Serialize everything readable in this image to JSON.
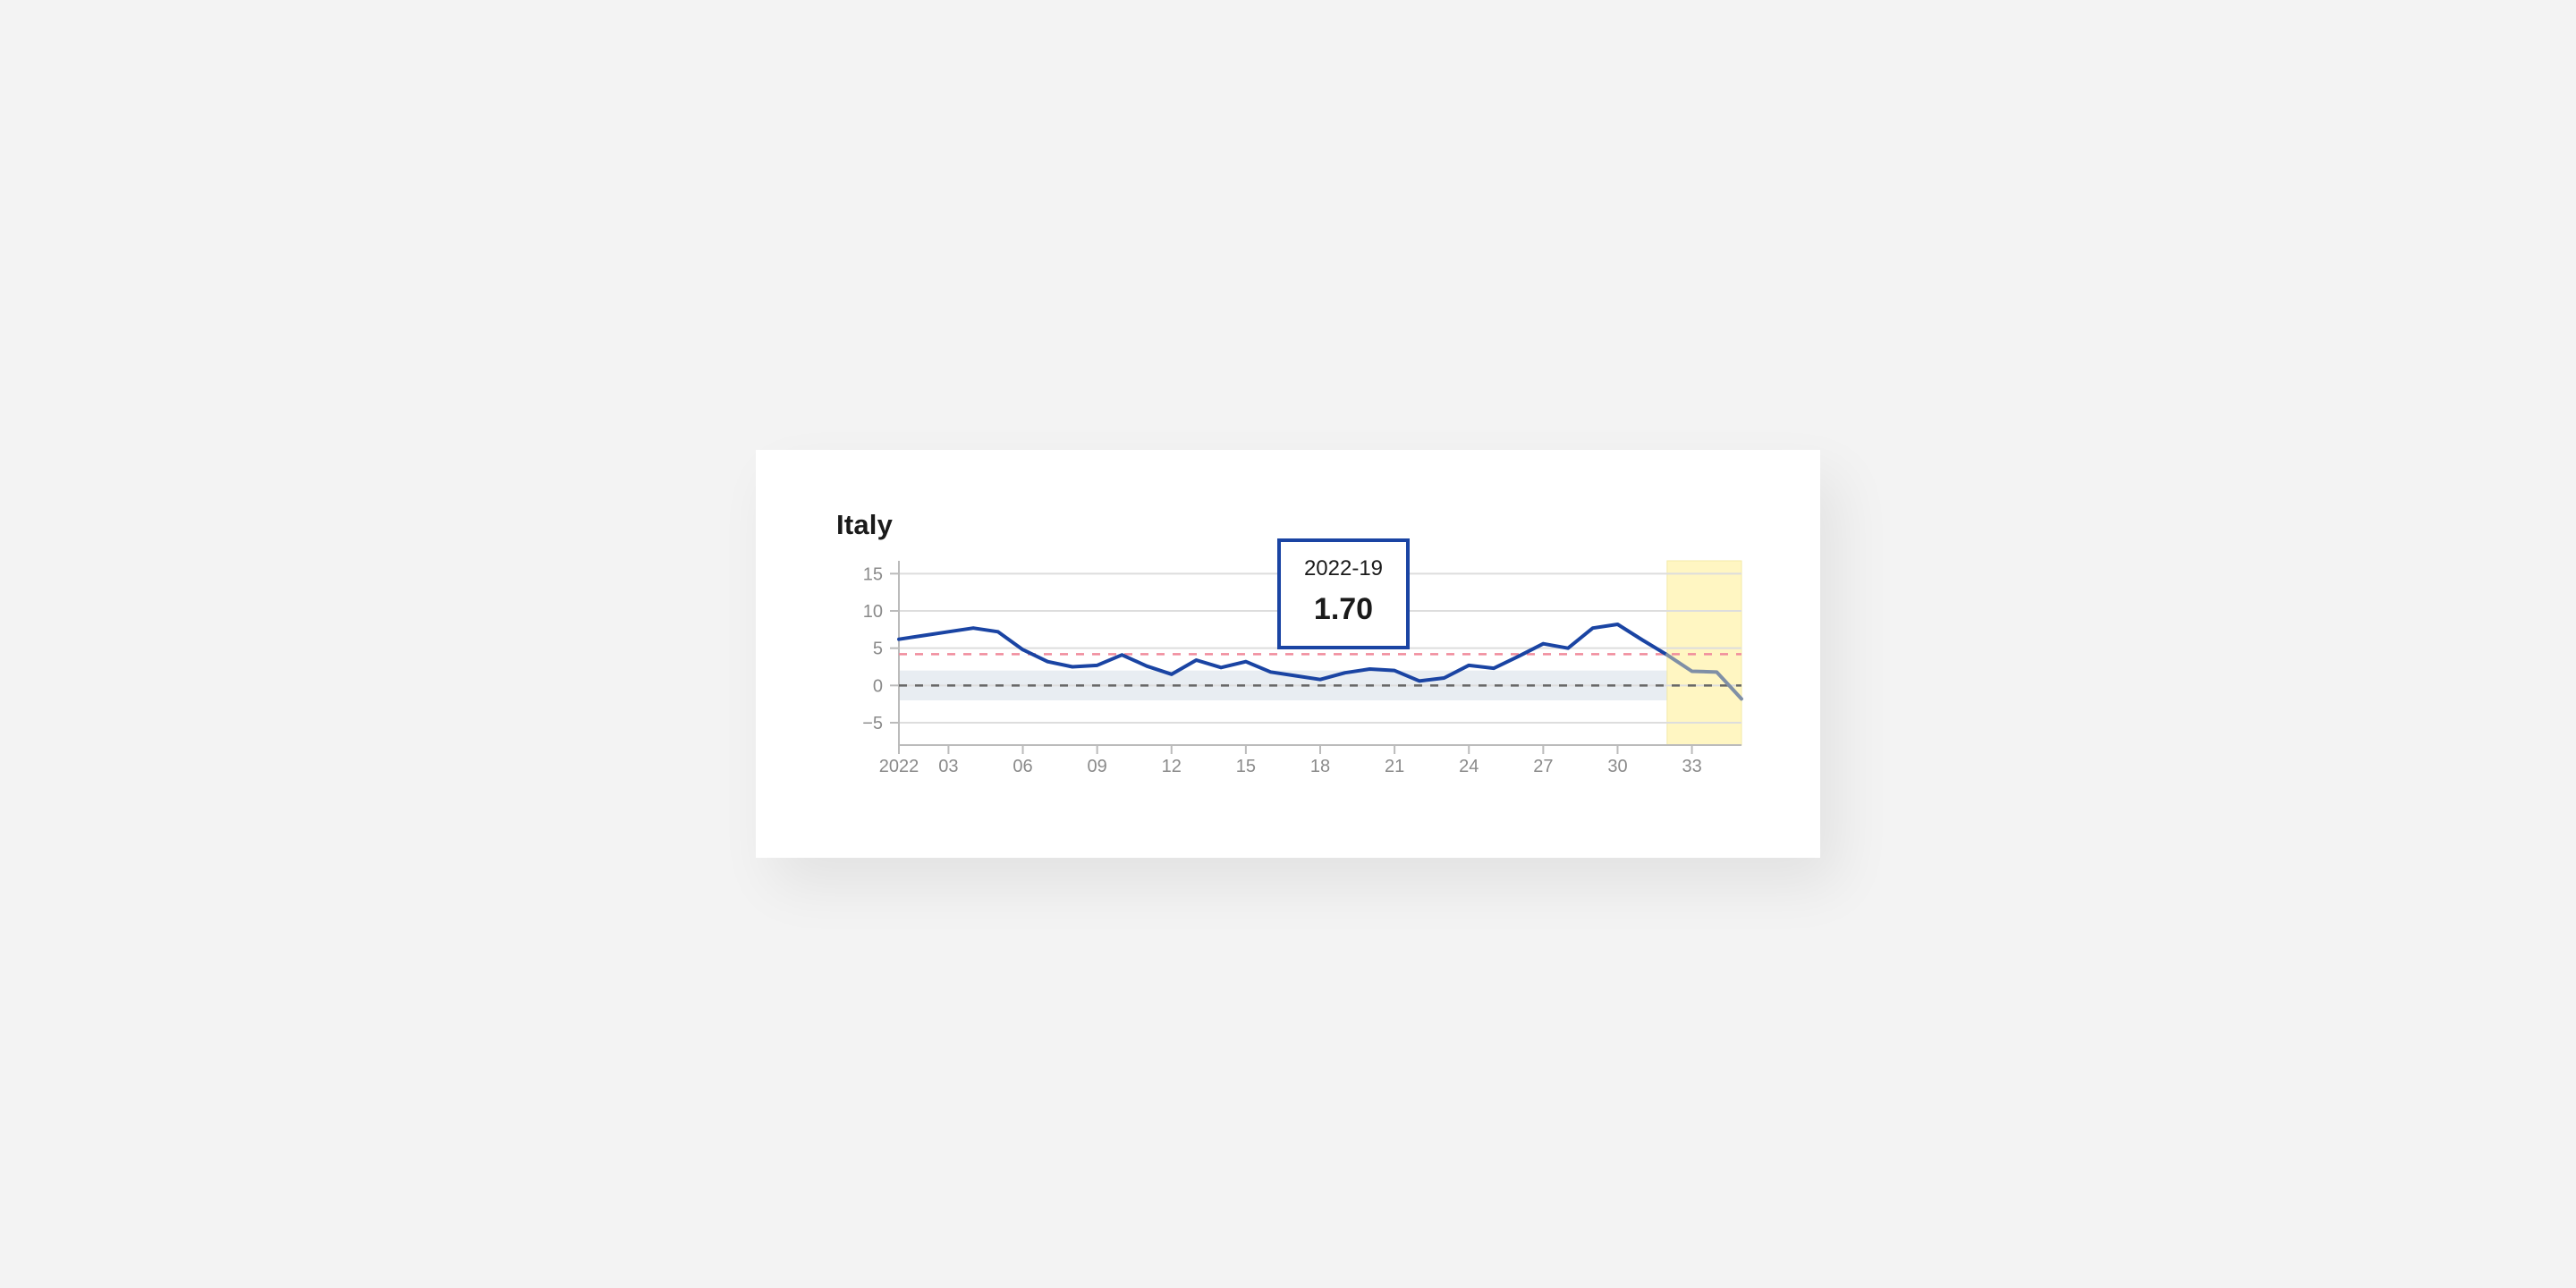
{
  "title": "Italy",
  "tooltip": {
    "week": "2022-19",
    "value": "1.70"
  },
  "colors": {
    "series_line": "#1a44a3",
    "forecast_line": "#7f8fa6",
    "threshold_line": "#f08c9c",
    "baseline_line": "#666666",
    "forecast_band": "#fff6c2",
    "baseline_band": "#e8edf2",
    "grid": "#dddddd"
  },
  "chart_data": {
    "type": "line",
    "title": "Italy",
    "x_unit": "ISO week of 2022",
    "ylim": [
      -8,
      16
    ],
    "y_ticks": [
      15,
      10,
      5,
      0,
      -5
    ],
    "x_ticks": [
      {
        "x": 1,
        "label": "2022"
      },
      {
        "x": 3,
        "label": "03"
      },
      {
        "x": 6,
        "label": "06"
      },
      {
        "x": 9,
        "label": "09"
      },
      {
        "x": 12,
        "label": "12"
      },
      {
        "x": 15,
        "label": "15"
      },
      {
        "x": 18,
        "label": "18"
      },
      {
        "x": 21,
        "label": "21"
      },
      {
        "x": 24,
        "label": "24"
      },
      {
        "x": 27,
        "label": "27"
      },
      {
        "x": 30,
        "label": "30"
      },
      {
        "x": 33,
        "label": "33"
      }
    ],
    "grid": true,
    "series": [
      {
        "x": [
          1,
          2,
          3,
          4,
          5,
          6,
          7,
          8,
          9,
          10,
          11,
          12,
          13,
          14,
          15,
          16,
          17,
          18,
          19,
          20,
          21,
          22,
          23,
          24,
          25,
          26,
          27,
          28,
          29,
          30,
          31,
          32
        ],
        "values": [
          6.2,
          6.7,
          7.2,
          7.7,
          7.2,
          4.8,
          3.2,
          2.5,
          2.7,
          4.1,
          2.6,
          1.5,
          3.4,
          2.4,
          3.2,
          1.8,
          1.3,
          0.8,
          1.7,
          2.2,
          2.0,
          0.6,
          1.0,
          2.7,
          2.3,
          3.9,
          5.6,
          5.0,
          7.7,
          8.2,
          6.1,
          4.1
        ]
      },
      {
        "style": "forecast",
        "x": [
          32,
          33,
          34,
          35
        ],
        "values": [
          4.1,
          1.9,
          1.8,
          -1.8
        ]
      }
    ],
    "reference_lines": [
      {
        "y": 4.2,
        "style": "dashed",
        "color": "#f08c9c"
      },
      {
        "y": 0,
        "style": "dashed",
        "color": "#666666"
      }
    ],
    "bands": [
      {
        "orientation": "horizontal",
        "y_from": -2,
        "y_to": 2
      },
      {
        "orientation": "vertical",
        "x_from": 32,
        "x_to": 35
      }
    ]
  }
}
